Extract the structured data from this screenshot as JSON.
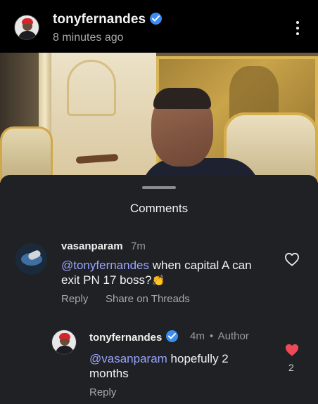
{
  "post": {
    "owner": "tonyfernandes",
    "time": "8 minutes ago"
  },
  "comments_sheet": {
    "title": "Comments",
    "comments": [
      {
        "user": "vasanparam",
        "time": "7m",
        "mention": "@tonyfernandes",
        "text": " when capital A can exit PN 17 boss?",
        "emoji": "👏",
        "actions": {
          "reply": "Reply",
          "share": "Share on Threads"
        },
        "liked": false
      }
    ],
    "reply": {
      "user": "tonyfernandes",
      "time": "4m",
      "separator": "•",
      "author_badge": "Author",
      "mention": "@vasanparam",
      "text": " hopefully 2 months",
      "actions": {
        "reply": "Reply"
      },
      "liked": true,
      "like_count": "2"
    }
  },
  "colors": {
    "verified": "#3b8df0",
    "mention": "#9aa4ff",
    "heart_liked": "#ed4956",
    "sheet_bg": "#1f2124"
  },
  "icons": {
    "verified": "verified-badge-icon",
    "more": "more-vertical-icon",
    "heart": "heart-icon"
  }
}
